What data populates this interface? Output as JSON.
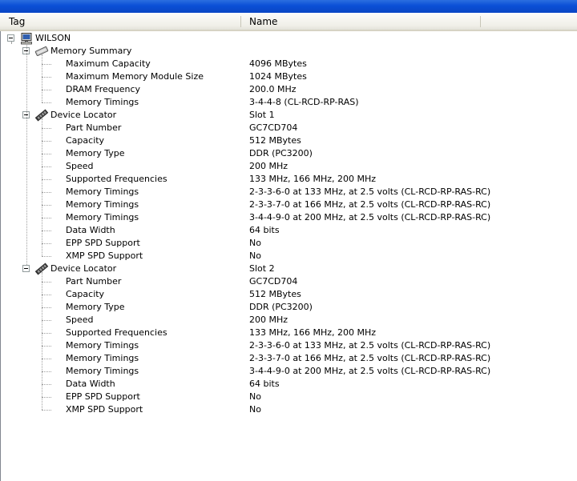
{
  "columns": {
    "tag": "Tag",
    "name": "Name"
  },
  "root": {
    "label": "WILSON",
    "icon": "computer-icon"
  },
  "memory_summary": {
    "label": "Memory Summary",
    "icon": "memory-module-icon",
    "items": [
      {
        "tag": "Maximum Capacity",
        "value": "4096 MBytes"
      },
      {
        "tag": "Maximum Memory Module Size",
        "value": "1024 MBytes"
      },
      {
        "tag": "DRAM Frequency",
        "value": "200.0 MHz"
      },
      {
        "tag": "Memory Timings",
        "value": "3-4-4-8 (CL-RCD-RP-RAS)"
      }
    ]
  },
  "slots": [
    {
      "label": "Device Locator",
      "value": "Slot 1",
      "icon": "ram-stick-icon",
      "items": [
        {
          "tag": "Part Number",
          "value": "GC7CD704"
        },
        {
          "tag": "Capacity",
          "value": "512 MBytes"
        },
        {
          "tag": "Memory Type",
          "value": "DDR (PC3200)"
        },
        {
          "tag": "Speed",
          "value": "200 MHz"
        },
        {
          "tag": "Supported Frequencies",
          "value": "133 MHz, 166 MHz, 200 MHz"
        },
        {
          "tag": "Memory Timings",
          "value": "2-3-3-6-0 at 133 MHz, at 2.5 volts (CL-RCD-RP-RAS-RC)"
        },
        {
          "tag": "Memory Timings",
          "value": "2-3-3-7-0 at 166 MHz, at 2.5 volts (CL-RCD-RP-RAS-RC)"
        },
        {
          "tag": "Memory Timings",
          "value": "3-4-4-9-0 at 200 MHz, at 2.5 volts (CL-RCD-RP-RAS-RC)"
        },
        {
          "tag": "Data Width",
          "value": "64 bits"
        },
        {
          "tag": "EPP SPD Support",
          "value": "No"
        },
        {
          "tag": "XMP SPD Support",
          "value": "No"
        }
      ]
    },
    {
      "label": "Device Locator",
      "value": "Slot 2",
      "icon": "ram-stick-icon",
      "items": [
        {
          "tag": "Part Number",
          "value": "GC7CD704"
        },
        {
          "tag": "Capacity",
          "value": "512 MBytes"
        },
        {
          "tag": "Memory Type",
          "value": "DDR (PC3200)"
        },
        {
          "tag": "Speed",
          "value": "200 MHz"
        },
        {
          "tag": "Supported Frequencies",
          "value": "133 MHz, 166 MHz, 200 MHz"
        },
        {
          "tag": "Memory Timings",
          "value": "2-3-3-6-0 at 133 MHz, at 2.5 volts (CL-RCD-RP-RAS-RC)"
        },
        {
          "tag": "Memory Timings",
          "value": "2-3-3-7-0 at 166 MHz, at 2.5 volts (CL-RCD-RP-RAS-RC)"
        },
        {
          "tag": "Memory Timings",
          "value": "3-4-4-9-0 at 200 MHz, at 2.5 volts (CL-RCD-RP-RAS-RC)"
        },
        {
          "tag": "Data Width",
          "value": "64 bits"
        },
        {
          "tag": "EPP SPD Support",
          "value": "No"
        },
        {
          "tag": "XMP SPD Support",
          "value": "No"
        }
      ]
    }
  ],
  "colors": {
    "titlebar": "#0a4fd6",
    "header_bg": "#f0efe8",
    "tree_line": "#a0a0a0",
    "expander_border": "#919b9c"
  }
}
